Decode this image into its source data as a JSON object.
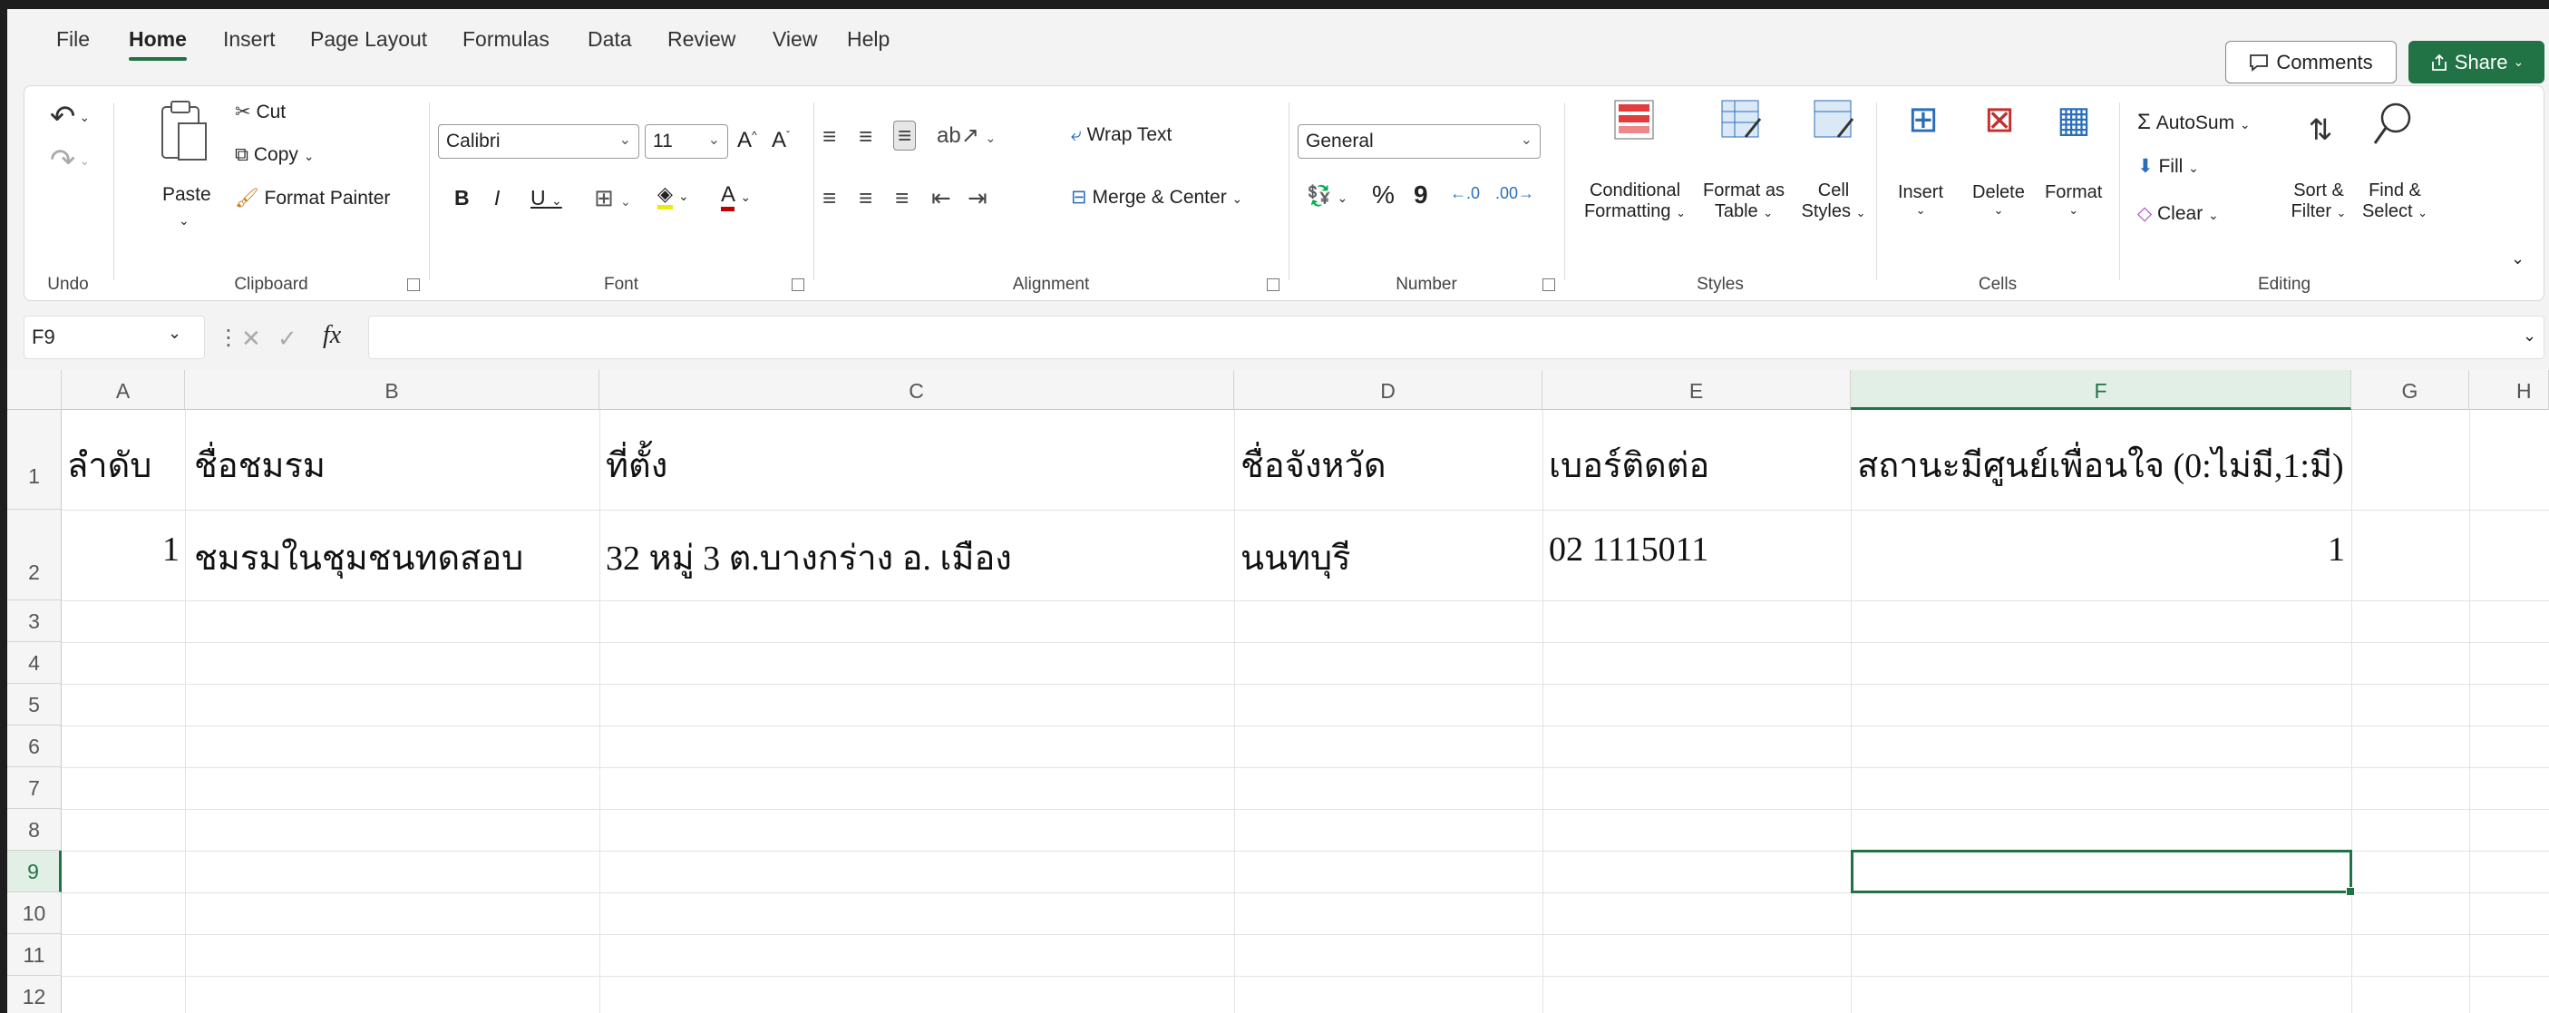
{
  "tabs": [
    "File",
    "Home",
    "Insert",
    "Page Layout",
    "Formulas",
    "Data",
    "Review",
    "View",
    "Help"
  ],
  "active_tab": "Home",
  "header_buttons": {
    "comments": "Comments",
    "share": "Share"
  },
  "ribbon": {
    "undo": {
      "label": "Undo"
    },
    "clipboard": {
      "label": "Clipboard",
      "paste": "Paste",
      "cut": "Cut",
      "copy": "Copy",
      "format_painter": "Format Painter"
    },
    "font": {
      "label": "Font",
      "font_name": "Calibri",
      "font_size": "11",
      "bold": "B",
      "italic": "I",
      "underline": "U",
      "grow": "A",
      "shrink": "A",
      "font_color": "A"
    },
    "alignment": {
      "label": "Alignment",
      "wrap_text": "Wrap Text",
      "merge_center": "Merge & Center"
    },
    "number": {
      "label": "Number",
      "format": "General",
      "percent": "%",
      "comma": "9"
    },
    "styles": {
      "label": "Styles",
      "conditional_1": "Conditional",
      "conditional_2": "Formatting",
      "format_table_1": "Format as",
      "format_table_2": "Table",
      "cell_styles_1": "Cell",
      "cell_styles_2": "Styles"
    },
    "cells": {
      "label": "Cells",
      "insert": "Insert",
      "delete": "Delete",
      "format": "Format"
    },
    "editing": {
      "label": "Editing",
      "autosum": "AutoSum",
      "fill": "Fill",
      "clear": "Clear",
      "sort_1": "Sort &",
      "sort_2": "Filter",
      "find_1": "Find &",
      "find_2": "Select"
    }
  },
  "formula_bar": {
    "name_box": "F9",
    "fx": "fx",
    "formula": ""
  },
  "columns": [
    "A",
    "B",
    "C",
    "D",
    "E",
    "F",
    "G",
    "H"
  ],
  "selected_column": "F",
  "rows": [
    "1",
    "2",
    "3",
    "4",
    "5",
    "6",
    "7",
    "8",
    "9",
    "10",
    "11",
    "12"
  ],
  "selected_row": "9",
  "cells": {
    "A1": "ลำดับ",
    "B1": "ชื่อชมรม",
    "C1": "ที่ตั้ง",
    "D1": "ชื่อจังหวัด",
    "E1": "เบอร์ติดต่อ",
    "F1": "สถานะมีศูนย์เพื่อนใจ (0:ไม่มี,1:มี)",
    "A2": "1",
    "B2": "ชมรมในชุมชนทดสอบ",
    "C2": "32 หมู่ 3 ต.บางกร่าง  อ. เมือง",
    "D2": "นนทบุรี",
    "E2": "02 1115011",
    "F2": "1"
  },
  "colors": {
    "accent": "#217346",
    "ribbon_bg": "#f3f3f3"
  }
}
